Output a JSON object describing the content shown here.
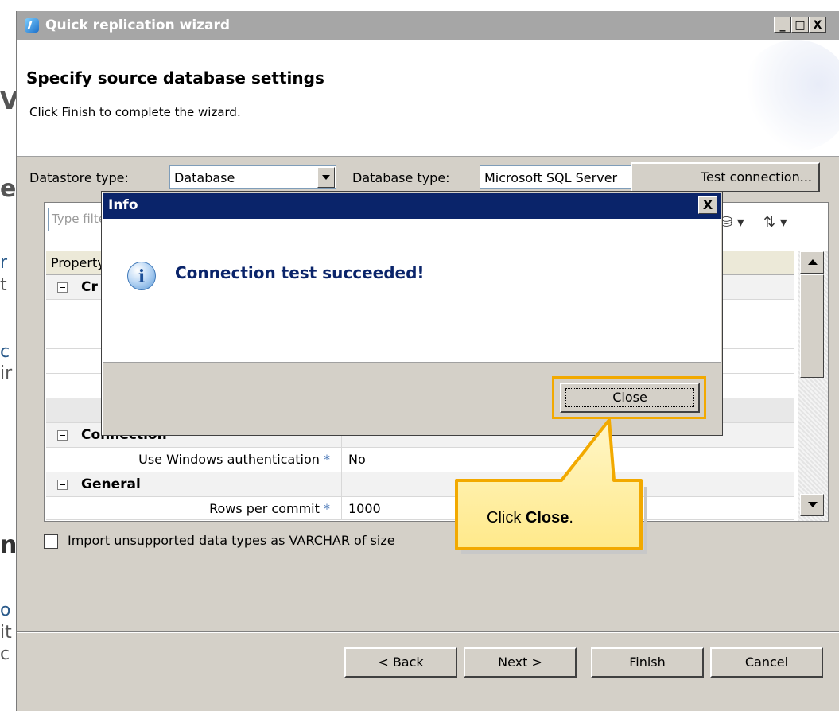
{
  "background": {
    "fragments": [
      "V",
      "e",
      "r",
      "t",
      "c",
      "ir",
      "n",
      "o",
      "it",
      "c"
    ]
  },
  "window": {
    "title": "Quick replication wizard",
    "controls": {
      "minimize": "_",
      "maximize": "□",
      "close": "X"
    }
  },
  "header": {
    "title": "Specify source database settings",
    "subtitle": "Click Finish to complete the wizard."
  },
  "form": {
    "datastore_type_label": "Datastore type:",
    "datastore_type_value": "Database",
    "database_type_label": "Database type:",
    "database_type_value": "Microsoft SQL Server",
    "test_connection_label": "Test connection..."
  },
  "grid": {
    "filter_placeholder": "Type filter text",
    "column_header": "Property",
    "categories": [
      {
        "label": "Cr"
      },
      {
        "label": "Connection"
      },
      {
        "label": "General"
      }
    ],
    "properties": [
      {
        "name": "Use Windows authentication",
        "value": "No"
      },
      {
        "name": "Rows per commit",
        "value": "1000"
      }
    ],
    "required_marker": "*"
  },
  "checkbox": {
    "label": "Import unsupported data types as VARCHAR of size"
  },
  "footer": {
    "back_label": "< Back",
    "next_label": "Next >",
    "finish_label": "Finish",
    "cancel_label": "Cancel"
  },
  "dialog": {
    "title": "Info",
    "close_x": "X",
    "message": "Connection test succeeded!",
    "close_label": "Close",
    "icon": "info-icon"
  },
  "callout": {
    "prefix": "Click ",
    "emphasis": "Close",
    "suffix": ".",
    "accent": "#f2a900",
    "fill": "#ffe98a"
  }
}
